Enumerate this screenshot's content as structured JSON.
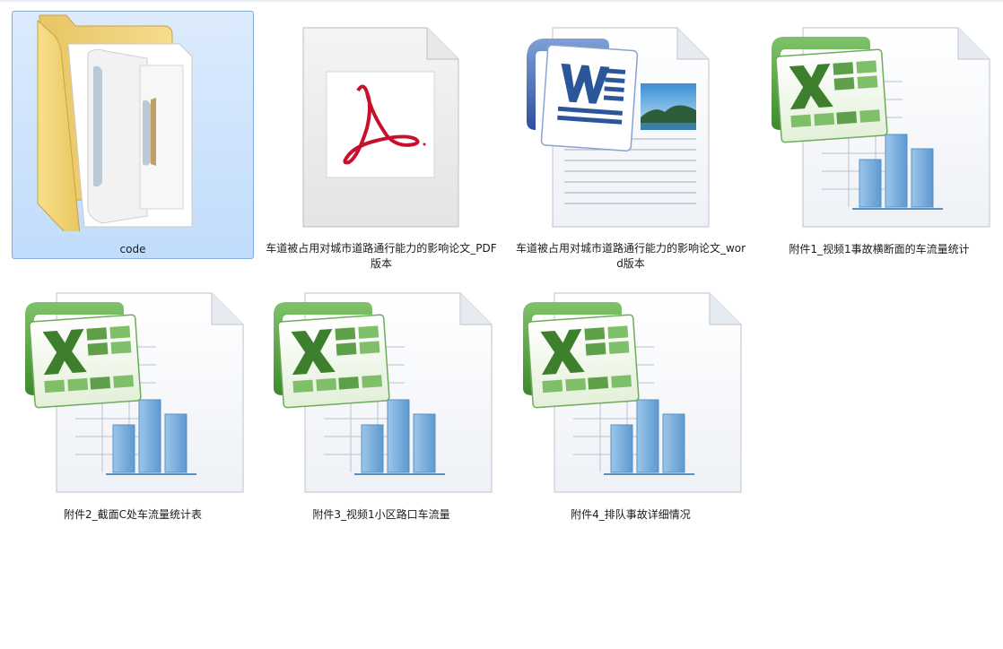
{
  "files": [
    {
      "name": "code",
      "type": "folder",
      "selected": true
    },
    {
      "name": "车道被占用对城市道路通行能力的影响论文_PDF版本",
      "type": "pdf"
    },
    {
      "name": "车道被占用对城市道路通行能力的影响论文_word版本",
      "type": "word"
    },
    {
      "name": "附件1_视频1事故横断面的车流量统计",
      "type": "excel"
    },
    {
      "name": "附件2_截面C处车流量统计表",
      "type": "excel"
    },
    {
      "name": "附件3_视频1小区路口车流量",
      "type": "excel"
    },
    {
      "name": "附件4_排队事故详细情况",
      "type": "excel"
    }
  ],
  "colors": {
    "selection_fill": "#cde3fb",
    "selection_border": "#84acdd",
    "pdf_red": "#c8102e",
    "word_blue": "#2b579a",
    "excel_green": "#4f9a3a",
    "chart_bar": "#7fb2de"
  }
}
